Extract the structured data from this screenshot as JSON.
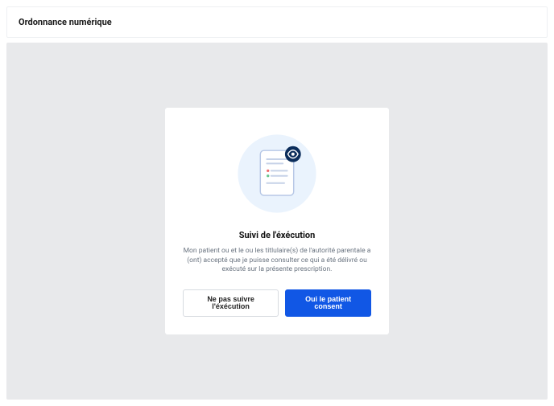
{
  "header": {
    "title": "Ordonnance numérique"
  },
  "dialog": {
    "title": "Suivi de l'éxécution",
    "description": "Mon patient ou et le ou les titlulaire(s) de l'autorité parentale a (ont) accepté que je puisse consulter ce qui a été délivré ou exécuté sur la présente prescription.",
    "secondary_label": "Ne pas suivre l'éxécution",
    "primary_label": "Oui le patient consent"
  },
  "colors": {
    "primary": "#1157e5",
    "illus_bg": "#eaf3fd",
    "doc_border": "#b7c8e6",
    "line": "#c6d2e8",
    "accent_red": "#ef6a6a",
    "accent_green": "#63c58b",
    "badge": "#0b2d5b"
  }
}
